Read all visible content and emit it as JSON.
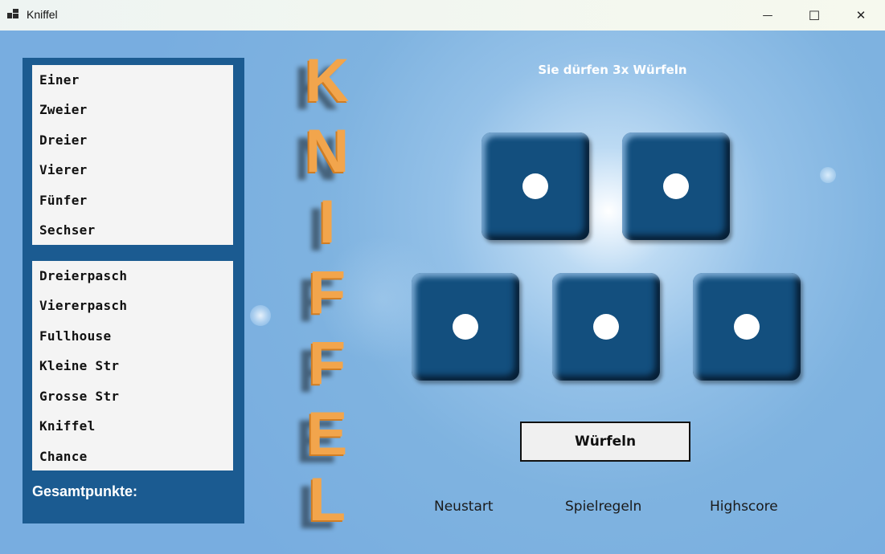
{
  "window": {
    "title": "Kniffel"
  },
  "titlebar": {
    "minimize_glyph": "—",
    "maximize_glyph": "☐",
    "close_glyph": "✕"
  },
  "scorecard": {
    "upper": [
      "Einer",
      "Zweier",
      "Dreier",
      "Vierer",
      "Fünfer",
      "Sechser"
    ],
    "lower": [
      "Dreierpasch",
      "Viererpasch",
      "Fullhouse",
      "Kleine Str",
      "Grosse Str",
      "Kniffel",
      "Chance"
    ],
    "total_label": "Gesamtpunkte:"
  },
  "logo": {
    "letters": [
      "K",
      "N",
      "I",
      "F",
      "F",
      "E",
      "L"
    ]
  },
  "status": "Sie dürfen 3x Würfeln",
  "dice": [
    1,
    1,
    1,
    1,
    1
  ],
  "roll_button": "Würfeln",
  "links": {
    "restart": "Neustart",
    "rules": "Spielregeln",
    "highscore": "Highscore"
  },
  "colors": {
    "panel": "#1b5b91",
    "die": "#134f7e",
    "logo": "#f2a54c",
    "background": "#7fb3e0"
  }
}
